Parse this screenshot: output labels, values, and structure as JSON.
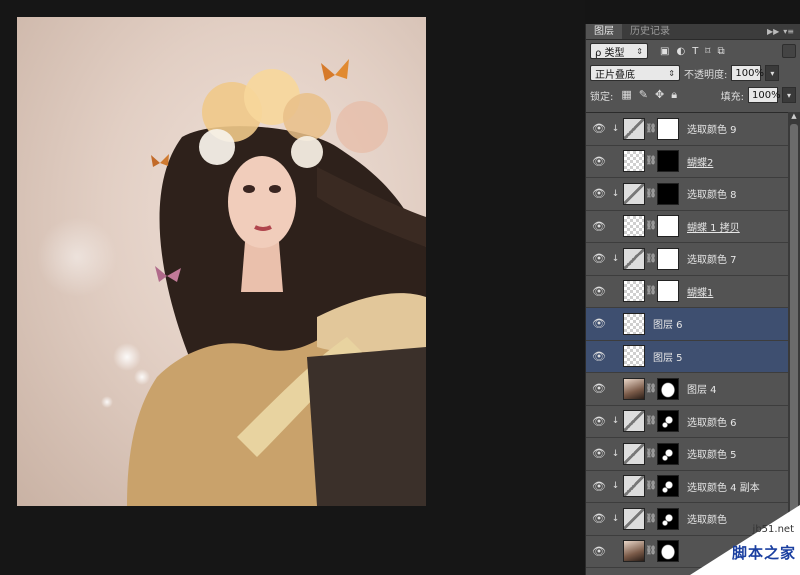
{
  "panel": {
    "tabs": [
      {
        "label": "图层",
        "active": true
      },
      {
        "label": "历史记录",
        "active": false
      }
    ],
    "filter": {
      "label": "ρ 类型",
      "icons": [
        "image-filter-icon",
        "adjustment-filter-icon",
        "type-filter-icon",
        "shape-filter-icon",
        "smart-object-filter-icon"
      ]
    },
    "blend_mode": "正片叠底",
    "opacity_label": "不透明度:",
    "opacity_value": "100%",
    "lock_label": "锁定:",
    "fill_label": "填充:",
    "fill_value": "100%"
  },
  "layers": [
    {
      "name": "选取颜色 9",
      "type": "adjustment",
      "clipped": true,
      "mask": "white",
      "selected": false,
      "underline": false
    },
    {
      "name": "蝴蝶2",
      "type": "smart",
      "clipped": false,
      "mask": "black",
      "selected": false,
      "underline": true
    },
    {
      "name": "选取颜色 8",
      "type": "adjustment",
      "clipped": true,
      "mask": "black",
      "selected": false,
      "underline": false
    },
    {
      "name": "蝴蝶 1 拷贝",
      "type": "smart",
      "clipped": false,
      "mask": "white",
      "selected": false,
      "underline": true
    },
    {
      "name": "选取颜色 7",
      "type": "adjustment",
      "clipped": true,
      "mask": "white",
      "selected": false,
      "underline": false
    },
    {
      "name": "蝴蝶1",
      "type": "smart",
      "clipped": false,
      "mask": "white",
      "selected": false,
      "underline": true
    },
    {
      "name": "图层 6",
      "type": "pixel",
      "clipped": false,
      "mask": "none",
      "selected": true,
      "underline": false
    },
    {
      "name": "图层 5",
      "type": "pixel",
      "clipped": false,
      "mask": "none",
      "selected": true,
      "underline": false
    },
    {
      "name": "图层 4",
      "type": "photo",
      "clipped": false,
      "mask": "figure",
      "selected": false,
      "underline": false
    },
    {
      "name": "选取颜色 6",
      "type": "adjustment",
      "clipped": true,
      "mask": "spots",
      "selected": false,
      "underline": false
    },
    {
      "name": "选取颜色 5",
      "type": "adjustment",
      "clipped": true,
      "mask": "spots",
      "selected": false,
      "underline": false
    },
    {
      "name": "选取颜色 4 副本",
      "type": "adjustment",
      "clipped": true,
      "mask": "spots",
      "selected": false,
      "underline": false
    },
    {
      "name": "选取颜色",
      "type": "adjustment",
      "clipped": true,
      "mask": "spots",
      "selected": false,
      "underline": false
    },
    {
      "name": "",
      "type": "photo",
      "clipped": false,
      "mask": "figure",
      "selected": false,
      "underline": false
    }
  ],
  "watermark": {
    "site": "jb51.net",
    "name": "脚本之家"
  }
}
